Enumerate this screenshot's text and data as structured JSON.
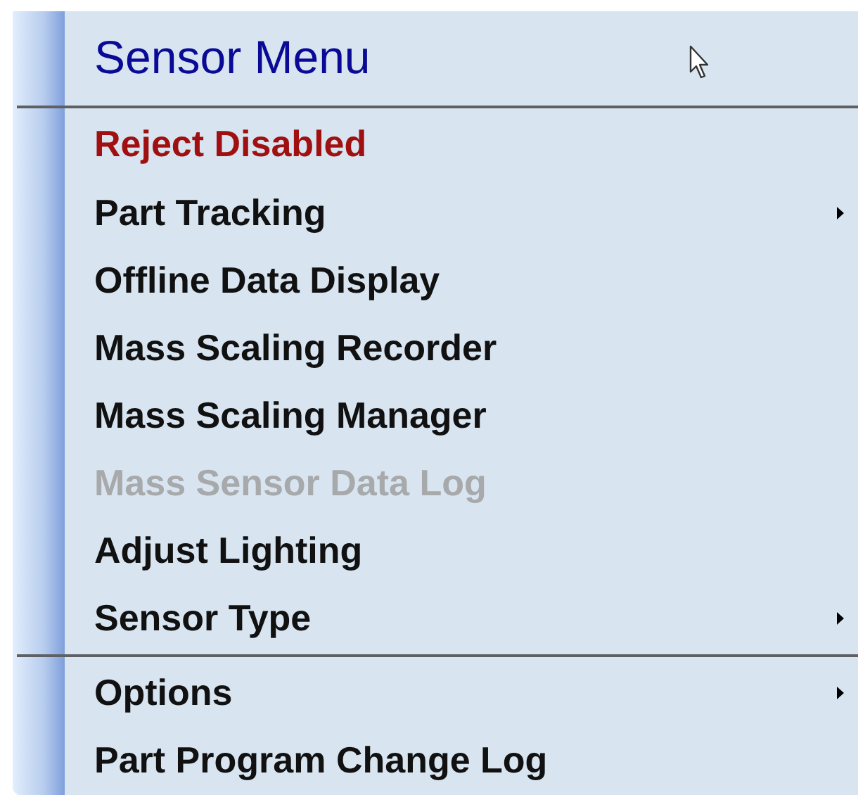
{
  "menu": {
    "title": "Sensor Menu",
    "groups": [
      {
        "items": [
          {
            "label": "Reject Disabled",
            "kind": "alert",
            "disabled": false,
            "submenu": false
          },
          {
            "label": "Part Tracking",
            "kind": "normal",
            "disabled": false,
            "submenu": true
          },
          {
            "label": "Offline Data Display",
            "kind": "normal",
            "disabled": false,
            "submenu": false
          },
          {
            "label": "Mass Scaling Recorder",
            "kind": "normal",
            "disabled": false,
            "submenu": false
          },
          {
            "label": "Mass Scaling Manager",
            "kind": "normal",
            "disabled": false,
            "submenu": false
          },
          {
            "label": "Mass Sensor Data Log",
            "kind": "normal",
            "disabled": true,
            "submenu": false
          },
          {
            "label": "Adjust Lighting",
            "kind": "normal",
            "disabled": false,
            "submenu": false
          },
          {
            "label": "Sensor Type",
            "kind": "normal",
            "disabled": false,
            "submenu": true
          }
        ]
      },
      {
        "items": [
          {
            "label": "Options",
            "kind": "normal",
            "disabled": false,
            "submenu": true
          },
          {
            "label": "Part Program Change Log",
            "kind": "normal",
            "disabled": false,
            "submenu": false
          }
        ]
      }
    ]
  }
}
